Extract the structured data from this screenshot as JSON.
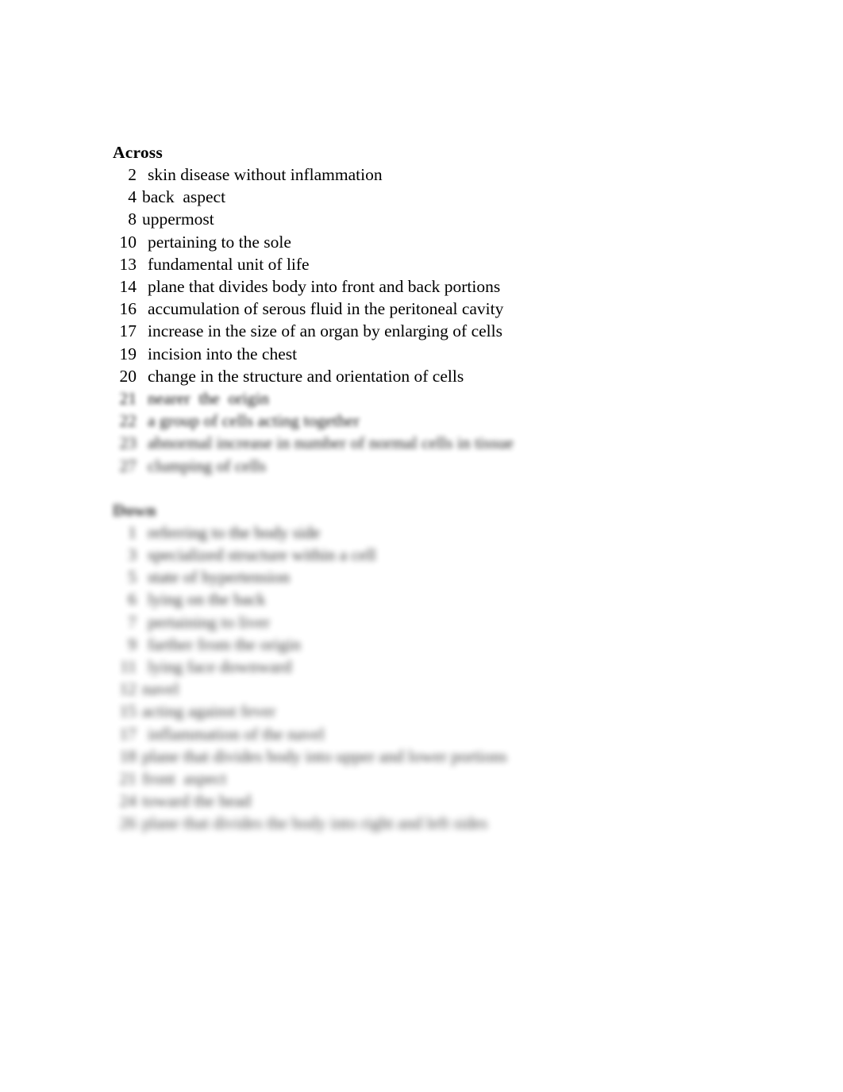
{
  "document": {
    "type": "crossword-clue-list",
    "page_background": "#ffffff",
    "text_color": "#000000"
  },
  "across": {
    "heading": "Across",
    "clues": [
      {
        "number": "2",
        "text": "skin disease without inflammation",
        "blur": 0
      },
      {
        "number": "4",
        "text": "back  aspect",
        "blur": 0
      },
      {
        "number": "8",
        "text": "uppermost",
        "blur": 0
      },
      {
        "number": "10",
        "text": "pertaining to the sole",
        "blur": 0
      },
      {
        "number": "13",
        "text": "fundamental unit of life",
        "blur": 0
      },
      {
        "number": "14",
        "text": "plane that divides body into front and back portions",
        "blur": 0
      },
      {
        "number": "16",
        "text": "accumulation of serous fluid in the peritoneal cavity",
        "blur": 0
      },
      {
        "number": "17",
        "text": "increase in the size of an organ by enlarging of cells",
        "blur": 0
      },
      {
        "number": "19",
        "text": "incision into the chest",
        "blur": 0
      },
      {
        "number": "20",
        "text": "change in the structure and orientation of cells",
        "blur": 0
      },
      {
        "number": "21",
        "text": "nearer  the  origin",
        "blur": 1
      },
      {
        "number": "22",
        "text": "a group of cells acting together",
        "blur": 2
      },
      {
        "number": "23",
        "text": "abnormal increase in number of normal cells in tissue",
        "blur": 3
      },
      {
        "number": "27",
        "text": "clumping of cells",
        "blur": 4
      }
    ]
  },
  "down": {
    "heading": "Down",
    "clues": [
      {
        "number": "1",
        "text": "referring to the body side",
        "blur": 6
      },
      {
        "number": "3",
        "text": "specialized structure within a cell",
        "blur": 7
      },
      {
        "number": "5",
        "text": "state of hypertension",
        "blur": 8
      },
      {
        "number": "6",
        "text": "lying on the back",
        "blur": 9
      },
      {
        "number": "7",
        "text": "pertaining to liver",
        "blur": 10
      },
      {
        "number": "9",
        "text": "farther from the origin",
        "blur": 11
      },
      {
        "number": "11",
        "text": "lying face downward",
        "blur": 12
      },
      {
        "number": "12",
        "text": "navel",
        "blur": 13
      },
      {
        "number": "15",
        "text": "acting against fever",
        "blur": 13
      },
      {
        "number": "17",
        "text": "inflammation of the navel",
        "blur": 14
      },
      {
        "number": "18",
        "text": "plane that divides body into upper and lower portions",
        "blur": 14
      },
      {
        "number": "21",
        "text": "front  aspect",
        "blur": 15
      },
      {
        "number": "24",
        "text": "toward the head",
        "blur": 15
      },
      {
        "number": "26",
        "text": "plane that divides the body into right and left sides",
        "blur": 16
      }
    ]
  }
}
